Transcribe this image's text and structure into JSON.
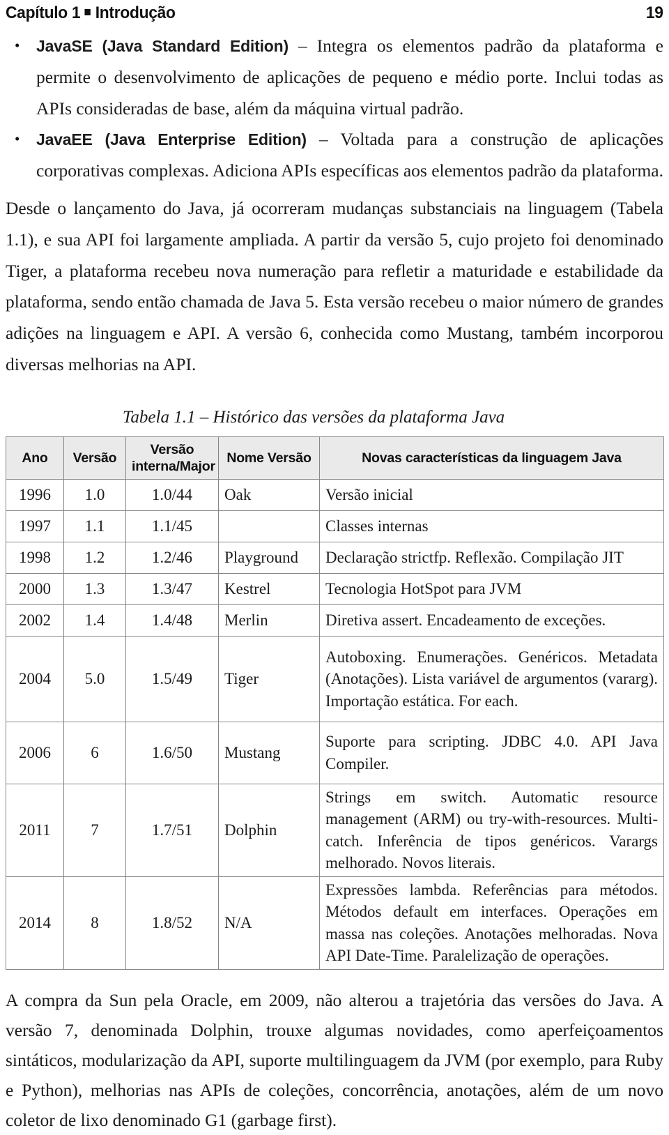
{
  "header": {
    "chapter_label": "Capítulo 1",
    "separator_icon": "square-bullet-icon",
    "chapter_title": "Introdução",
    "page_number": "19"
  },
  "bullets": [
    {
      "lead": "JavaSE (Java Standard Edition)",
      "text": " – Integra os elementos padrão da plataforma e permite o desenvolvimento de aplicações de pequeno e médio porte. Inclui todas as APIs consideradas de base, além da máquina virtual padrão."
    },
    {
      "lead": "JavaEE (Java Enterprise Edition)",
      "text": " – Voltada para a construção de aplicações corporativas complexas. Adiciona APIs específicas aos elementos padrão da plataforma."
    }
  ],
  "paragraphs": {
    "intro": "Desde o lançamento do Java, já ocorreram mudanças substanciais na linguagem (Tabela 1.1), e sua API foi largamente ampliada. A partir da versão 5, cujo projeto foi denominado Tiger, a plataforma recebeu nova numeração para refletir a maturidade e estabilidade da plataforma, sendo então chamada de Java 5. Esta versão recebeu o maior número de grandes adições na linguagem e API. A versão 6, conhecida como Mustang, também incorporou diversas melhorias na API.",
    "tail": "A compra da Sun pela Oracle, em 2009, não alterou a trajetória das versões do Java. A versão 7, denominada Dolphin, trouxe algumas novidades, como aperfeiçoamentos sintáticos, modularização da API, suporte multilinguagem da JVM (por exemplo, para Ruby e Python), melhorias nas APIs de coleções, concorrência, anotações, além de um novo coletor de lixo denominado G1 (garbage first)."
  },
  "table": {
    "caption": "Tabela 1.1 – Histórico das versões da plataforma Java",
    "columns": [
      "Ano",
      "Versão",
      "Versão interna/Major",
      "Nome Versão",
      "Novas características da linguagem Java"
    ],
    "rows": [
      {
        "ano": "1996",
        "versao": "1.0",
        "interna": "1.0/44",
        "nome": "Oak",
        "novidades": "Versão inicial"
      },
      {
        "ano": "1997",
        "versao": "1.1",
        "interna": "1.1/45",
        "nome": "",
        "novidades": "Classes internas"
      },
      {
        "ano": "1998",
        "versao": "1.2",
        "interna": "1.2/46",
        "nome": "Playground",
        "novidades": "Declaração strictfp. Reflexão. Compilação JIT"
      },
      {
        "ano": "2000",
        "versao": "1.3",
        "interna": "1.3/47",
        "nome": "Kestrel",
        "novidades": "Tecnologia HotSpot para JVM"
      },
      {
        "ano": "2002",
        "versao": "1.4",
        "interna": "1.4/48",
        "nome": "Merlin",
        "novidades": "Diretiva assert. Encadeamento de exceções."
      },
      {
        "ano": "2004",
        "versao": "5.0",
        "interna": "1.5/49",
        "nome": "Tiger",
        "novidades": "Autoboxing. Enumerações. Genéricos. Metadata (Anotações). Lista variável de argumentos (vararg). Importação estática. For each."
      },
      {
        "ano": "2006",
        "versao": "6",
        "interna": "1.6/50",
        "nome": "Mustang",
        "novidades": "Suporte para scripting. JDBC 4.0. API Java Compiler."
      },
      {
        "ano": "2011",
        "versao": "7",
        "interna": "1.7/51",
        "nome": "Dolphin",
        "novidades": "Strings em switch. Automatic resource management (ARM) ou try-with-resources. Multi-catch. Inferência de tipos genéricos. Varargs melhorado. Novos literais."
      },
      {
        "ano": "2014",
        "versao": "8",
        "interna": "1.8/52",
        "nome": "N/A",
        "novidades": "Expressões lambda. Referências para métodos. Métodos default em interfaces. Operações em massa nas coleções. Anotações melhoradas. Nova API Date-Time. Paralelização de operações."
      }
    ]
  },
  "colors": {
    "text": "#1c1c1c",
    "table_border": "#878787",
    "table_header_bg": "#eaeaea"
  }
}
